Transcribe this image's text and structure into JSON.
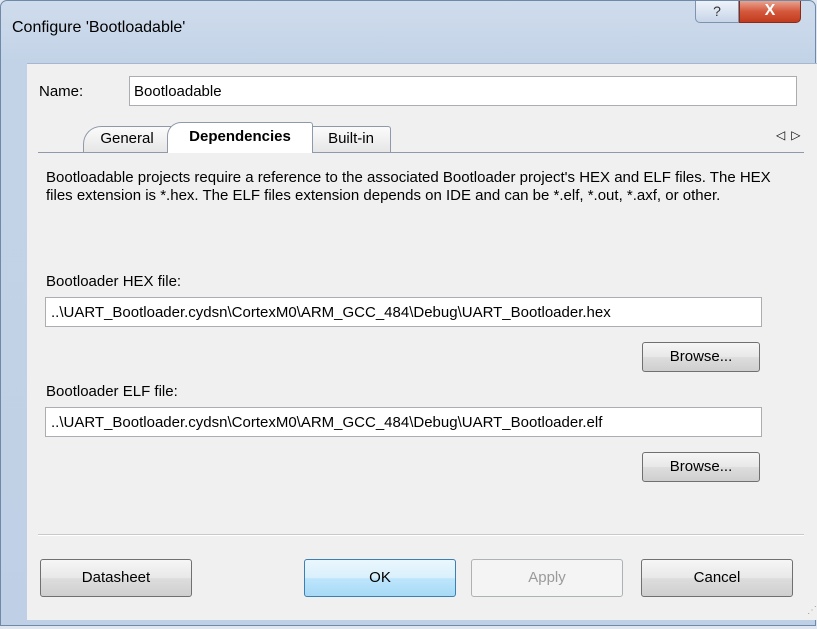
{
  "window": {
    "title": "Configure 'Bootloadable'",
    "help_glyph": "?",
    "close_glyph": "X"
  },
  "name": {
    "label": "Name:",
    "value": "Bootloadable"
  },
  "tabs": [
    {
      "label": "General",
      "active": false
    },
    {
      "label": "Dependencies",
      "active": true
    },
    {
      "label": "Built-in",
      "active": false
    }
  ],
  "tab_scroll": {
    "left": "◁",
    "right": "▷"
  },
  "dependencies": {
    "description": "Bootloadable projects require a reference to the associated Bootloader project's HEX and ELF files. The HEX files extension is *.hex. The ELF files extension depends on IDE and can be *.elf, *.out, *.axf, or other.",
    "hex_label": "Bootloader HEX file:",
    "hex_path": "..\\UART_Bootloader.cydsn\\CortexM0\\ARM_GCC_484\\Debug\\UART_Bootloader.hex",
    "hex_browse": "Browse...",
    "elf_label": "Bootloader ELF file:",
    "elf_path": "..\\UART_Bootloader.cydsn\\CortexM0\\ARM_GCC_484\\Debug\\UART_Bootloader.elf",
    "elf_browse": "Browse..."
  },
  "buttons": {
    "datasheet": "Datasheet",
    "ok": "OK",
    "apply": "Apply",
    "cancel": "Cancel"
  }
}
